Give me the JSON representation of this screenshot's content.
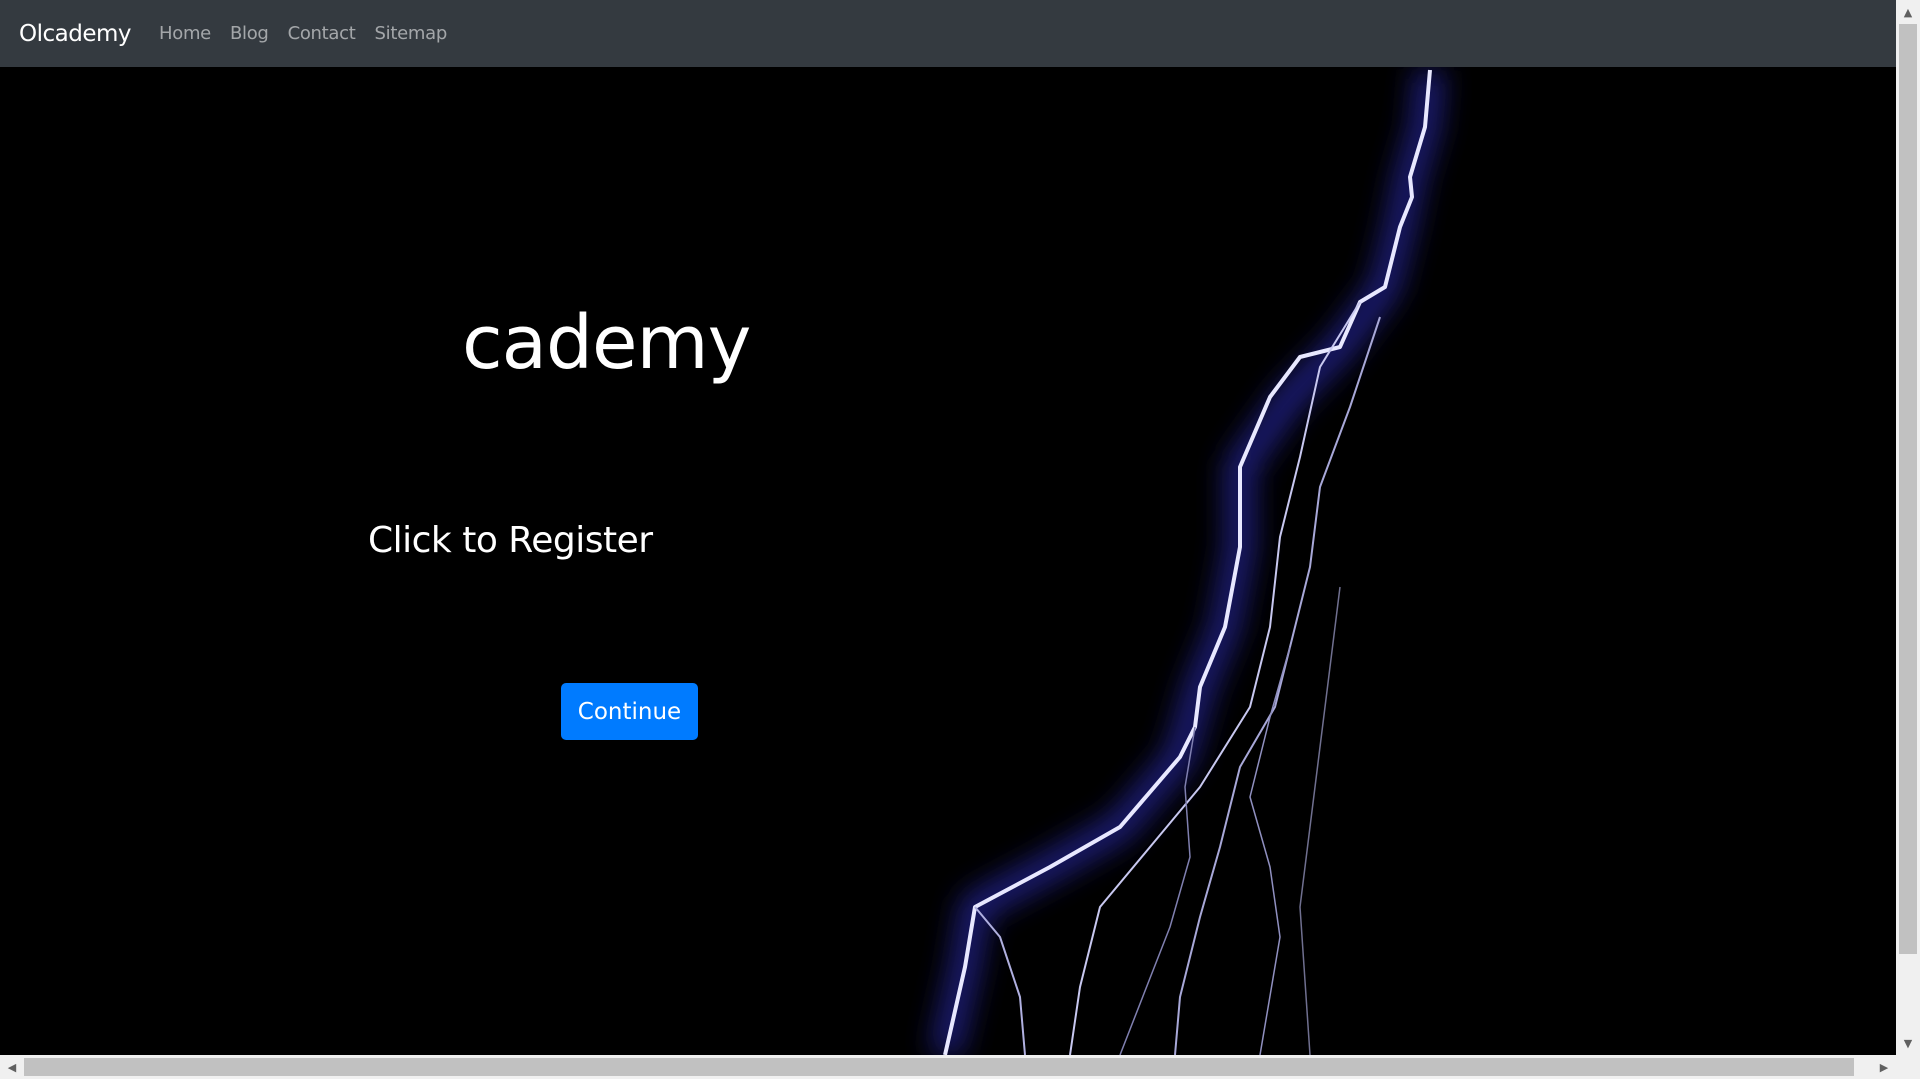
{
  "navbar": {
    "brand": "Olcademy",
    "links": [
      "Home",
      "Blog",
      "Contact",
      "Sitemap"
    ]
  },
  "hero": {
    "title": "cademy",
    "subtitle": "Click to Register",
    "button": "Continue"
  },
  "colors": {
    "navbar": "#343a40",
    "accent": "#007bff",
    "background": "#000000"
  }
}
